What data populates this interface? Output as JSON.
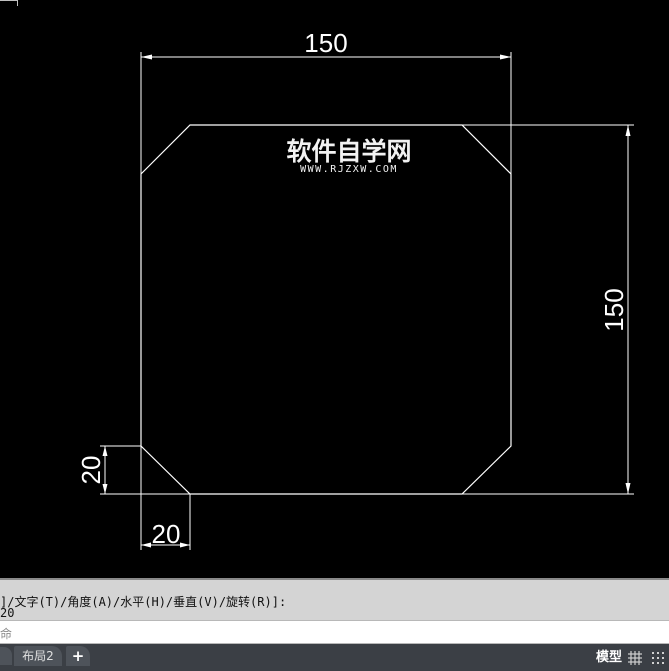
{
  "drawing": {
    "dimensions": {
      "top_width": "150",
      "right_height": "150",
      "chamfer_vertical": "20",
      "chamfer_horizontal": "20"
    },
    "watermark": {
      "title": "软件自学网",
      "url": "WWW.RJZXW.COM"
    }
  },
  "command_line": {
    "history_line_1": "]/文字(T)/角度(A)/水平(H)/垂直(V)/旋转(R)]:",
    "history_line_2": "20",
    "input_placeholder": "命"
  },
  "statusbar": {
    "layout_tab": "布局2",
    "add_tab": "+",
    "model_button": "模型"
  },
  "colors": {
    "canvas_bg": "#000000",
    "linework": "#ffffff",
    "command_bg": "#d4d4d4",
    "statusbar_bg": "#3b3f45"
  }
}
